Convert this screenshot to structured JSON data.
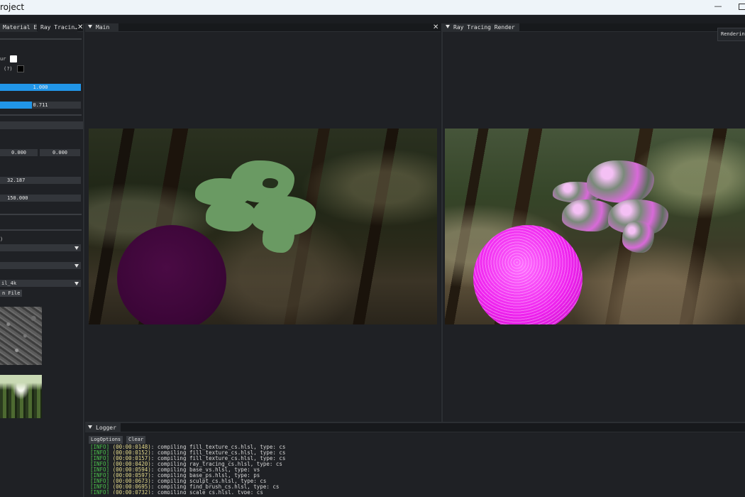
{
  "window": {
    "title": "roject",
    "minimize_glyph": "—"
  },
  "left_panel": {
    "tabs": [
      {
        "label": "Material E…"
      },
      {
        "label": "Ray Tracin…"
      }
    ],
    "close_glyph": "✕",
    "colour_label": "ur",
    "help_marker": "(?)",
    "slider_1": {
      "text": "1.000",
      "fill": 1.0
    },
    "slider_2": {
      "text": "0.711",
      "fill": 0.711
    },
    "vec_x": "0.000",
    "vec_y": "0.000",
    "field_a": "32.187",
    "field_b": "150.000",
    "paren_label": ")",
    "dropdown_3": {
      "value": "il_4k"
    },
    "open_file_button": "n File"
  },
  "main_view": {
    "tab": "Main",
    "close_glyph": "✕"
  },
  "raytrace_view": {
    "tab": "Ray Tracing Render",
    "badge": "Renderin"
  },
  "logger": {
    "tab": "Logger",
    "log_options_button": "LogOptions",
    "clear_button": "Clear",
    "lines": [
      {
        "level": "[INFO]",
        "time": "(00:00:0148)",
        "msg": ": compiling fill_texture_cs.hlsl, type: cs"
      },
      {
        "level": "[INFO]",
        "time": "(00:00:0152)",
        "msg": ": compiling fill_texture_cs.hlsl, type: cs"
      },
      {
        "level": "[INFO]",
        "time": "(00:00:0157)",
        "msg": ": compiling fill_texture_cs.hlsl, type: cs"
      },
      {
        "level": "[INFO]",
        "time": "(00:00:0420)",
        "msg": ": compiling ray_tracing_cs.hlsl, type: cs"
      },
      {
        "level": "[INFO]",
        "time": "(00:00:0594)",
        "msg": ": compiling base_vs.hlsl, type: vs"
      },
      {
        "level": "[INFO]",
        "time": "(00:00:0597)",
        "msg": ": compiling base_ps.hlsl, type: ps"
      },
      {
        "level": "[INFO]",
        "time": "(00:00:0673)",
        "msg": ": compiling sculpt_cs.hlsl, type: cs"
      },
      {
        "level": "[INFO]",
        "time": "(00:00:0695)",
        "msg": ": compiling find_brush_cs.hlsl, type: cs"
      },
      {
        "level": "[INFO]",
        "time": "(00:00:0732)",
        "msg": ": compiling scale_cs.hlsl, type: cs"
      }
    ]
  },
  "colors": {
    "accent": "#2196e8",
    "sphere_dark": "#3c0638",
    "sphere_pink": "#ee22ee",
    "blob_green": "#6a9a63",
    "log_level": "#4cc44c",
    "log_time": "#e4d98a"
  }
}
